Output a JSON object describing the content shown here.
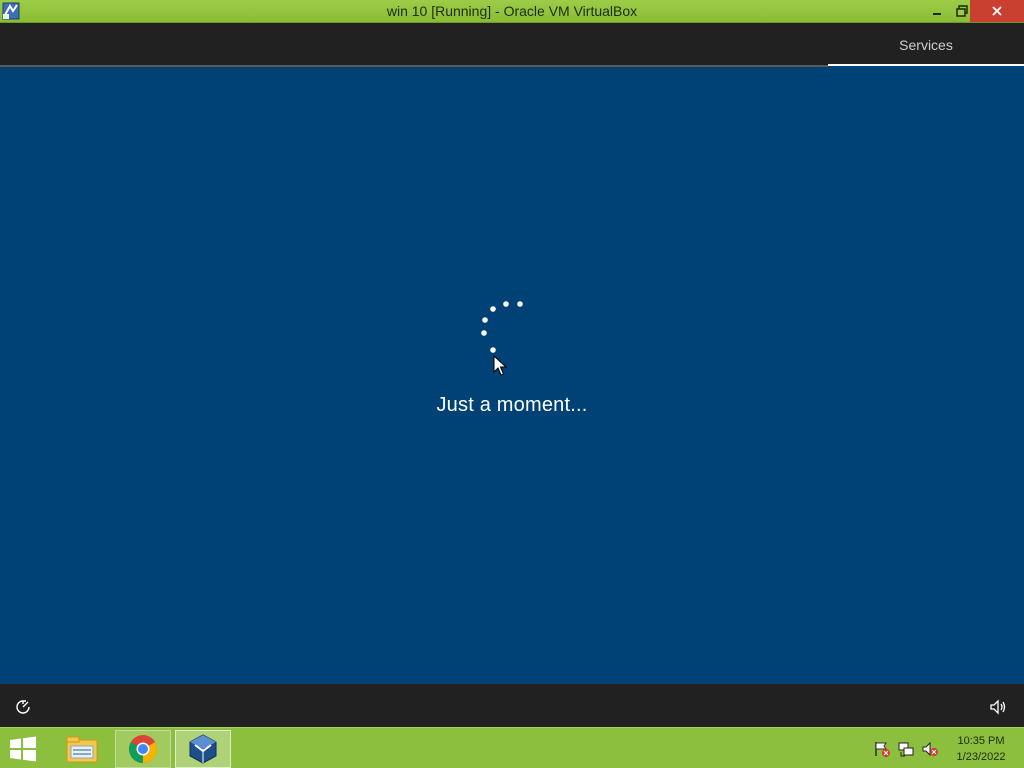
{
  "window": {
    "title": "win 10 [Running] - Oracle VM VirtualBox",
    "controls": [
      "minimize-icon",
      "restore-icon",
      "close-icon"
    ]
  },
  "vm_screen": {
    "top_bar": {
      "services_label": "Services"
    },
    "message": "Just a moment...",
    "bottom_bar": {
      "left_icon": "ease-of-access-icon",
      "right_icon": "volume-icon"
    }
  },
  "taskbar": {
    "pinned": [
      "windows-start-icon",
      "file-explorer-icon",
      "chrome-icon",
      "virtualbox-icon"
    ],
    "tray_icons": [
      "action-center-flag-icon",
      "network-icon",
      "volume-muted-icon"
    ],
    "clock": {
      "time": "10:35 PM",
      "date": "1/23/2022"
    }
  },
  "colors": {
    "vm_background": "#004275",
    "vm_bars": "#212121",
    "host_accent": "#8dbf3e",
    "close_button": "#c94031"
  }
}
